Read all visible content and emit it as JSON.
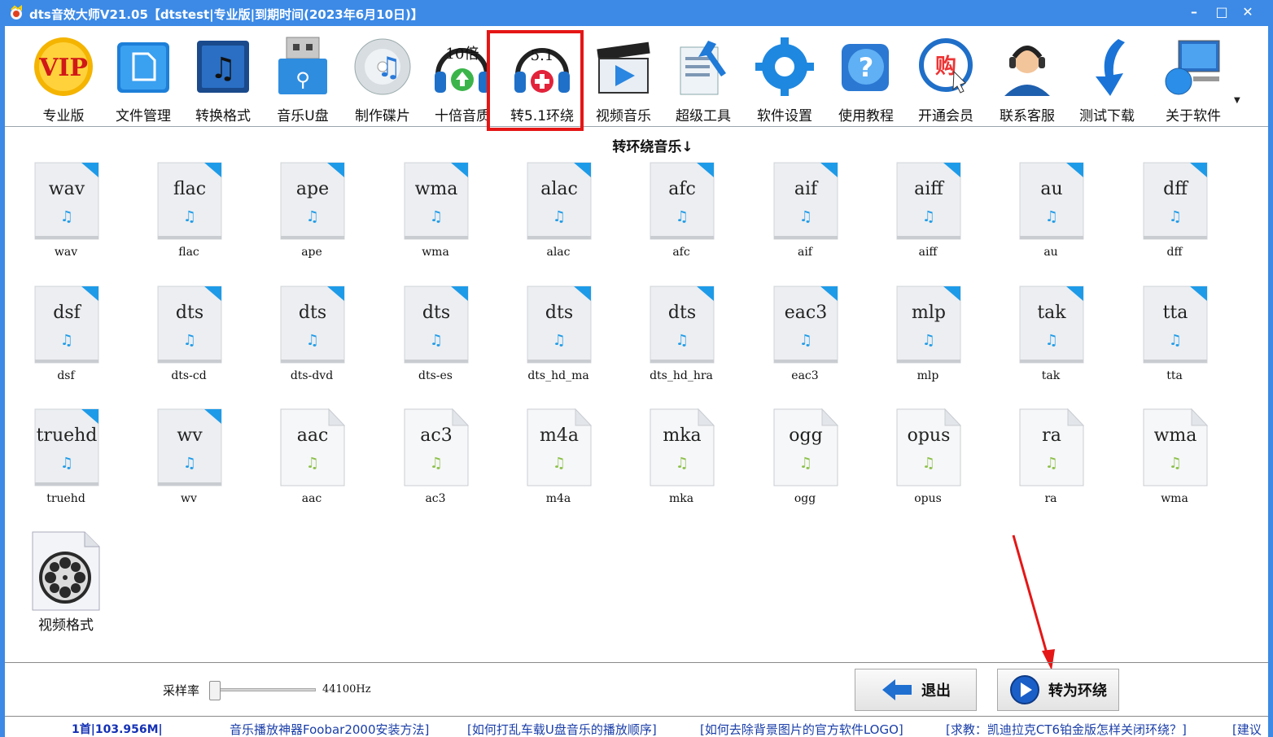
{
  "window": {
    "title": "dts音效大师V21.05【dtstest|专业版|到期时间(2023年6月10日)】",
    "minimize": "–",
    "maximize": "□",
    "close": "✕"
  },
  "toolbar": {
    "items": [
      {
        "label": "专业版",
        "icon": "vip-icon"
      },
      {
        "label": "文件管理",
        "icon": "file-manage-icon"
      },
      {
        "label": "转换格式",
        "icon": "convert-format-icon"
      },
      {
        "label": "音乐U盘",
        "icon": "usb-music-icon"
      },
      {
        "label": "制作碟片",
        "icon": "disc-icon"
      },
      {
        "label": "十倍音质",
        "icon": "ten-times-quality-icon",
        "badge": "10倍"
      },
      {
        "label": "转5.1环绕",
        "icon": "surround-51-icon",
        "badge": "5.1"
      },
      {
        "label": "视频音乐",
        "icon": "video-music-icon"
      },
      {
        "label": "超级工具",
        "icon": "super-tools-icon"
      },
      {
        "label": "软件设置",
        "icon": "settings-gear-icon"
      },
      {
        "label": "使用教程",
        "icon": "help-icon"
      },
      {
        "label": "开通会员",
        "icon": "membership-icon",
        "badge": "购"
      },
      {
        "label": "联系客服",
        "icon": "customer-service-icon"
      },
      {
        "label": "测试下载",
        "icon": "download-arrow-icon"
      },
      {
        "label": "关于软件",
        "icon": "about-computer-icon"
      }
    ]
  },
  "section": {
    "title": "转环绕音乐↓"
  },
  "formats": [
    {
      "ext": "wav",
      "name": "wav",
      "kind": "blue"
    },
    {
      "ext": "flac",
      "name": "flac",
      "kind": "blue"
    },
    {
      "ext": "ape",
      "name": "ape",
      "kind": "blue"
    },
    {
      "ext": "wma",
      "name": "wma",
      "kind": "blue"
    },
    {
      "ext": "alac",
      "name": "alac",
      "kind": "blue"
    },
    {
      "ext": "afc",
      "name": "afc",
      "kind": "blue"
    },
    {
      "ext": "aif",
      "name": "aif",
      "kind": "blue"
    },
    {
      "ext": "aiff",
      "name": "aiff",
      "kind": "blue"
    },
    {
      "ext": "au",
      "name": "au",
      "kind": "blue"
    },
    {
      "ext": "dff",
      "name": "dff",
      "kind": "blue"
    },
    {
      "ext": "dsf",
      "name": "dsf",
      "kind": "blue"
    },
    {
      "ext": "dts",
      "name": "dts-cd",
      "kind": "blue"
    },
    {
      "ext": "dts",
      "name": "dts-dvd",
      "kind": "blue"
    },
    {
      "ext": "dts",
      "name": "dts-es",
      "kind": "blue"
    },
    {
      "ext": "dts",
      "name": "dts_hd_ma",
      "kind": "blue"
    },
    {
      "ext": "dts",
      "name": "dts_hd_hra",
      "kind": "blue"
    },
    {
      "ext": "eac3",
      "name": "eac3",
      "kind": "blue"
    },
    {
      "ext": "mlp",
      "name": "mlp",
      "kind": "blue"
    },
    {
      "ext": "tak",
      "name": "tak",
      "kind": "blue"
    },
    {
      "ext": "tta",
      "name": "tta",
      "kind": "blue"
    },
    {
      "ext": "truehd",
      "name": "truehd",
      "kind": "blue"
    },
    {
      "ext": "wv",
      "name": "wv",
      "kind": "blue"
    },
    {
      "ext": "aac",
      "name": "aac",
      "kind": "green"
    },
    {
      "ext": "ac3",
      "name": "ac3",
      "kind": "green"
    },
    {
      "ext": "m4a",
      "name": "m4a",
      "kind": "green"
    },
    {
      "ext": "mka",
      "name": "mka",
      "kind": "green"
    },
    {
      "ext": "ogg",
      "name": "ogg",
      "kind": "green"
    },
    {
      "ext": "opus",
      "name": "opus",
      "kind": "green"
    },
    {
      "ext": "ra",
      "name": "ra",
      "kind": "green"
    },
    {
      "ext": "wma",
      "name": "wma",
      "kind": "green"
    }
  ],
  "video_format": {
    "label": "视频格式",
    "icon": "film-reel-icon"
  },
  "sample_rate": {
    "label": "采样率",
    "value": "44100Hz",
    "slider_level": 0
  },
  "buttons": {
    "exit": "退出",
    "convert": "转为环绕"
  },
  "status": {
    "count": "1首|103.956M|",
    "links": [
      "音乐播放神器Foobar2000安装方法]",
      "[如何打乱车载U盘音乐的播放顺序]",
      "[如何去除背景图片的官方软件LOGO]",
      "[求教：凯迪拉克CT6铂金版怎样关闭环绕？]",
      "[建议"
    ]
  },
  "colors": {
    "titlebar": "#3c8ae6",
    "highlight": "#e51616",
    "note_blue": "#1e9be8",
    "note_green": "#8cc04a",
    "corner_blue": "#1e9be8",
    "link_blue": "#1a3ea8"
  }
}
